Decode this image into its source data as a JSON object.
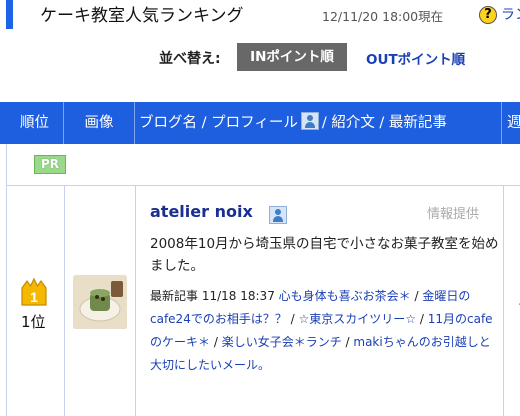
{
  "header": {
    "title": "ケーキ教室人気ランキング",
    "date": "12/11/20 18:00現在",
    "help_link": "ラン"
  },
  "sort": {
    "label": "並べ替え:",
    "active": "INポイント順",
    "other": "OUTポイント順"
  },
  "table": {
    "columns": {
      "rank": "順位",
      "image": "画像",
      "blog_part1": "ブログ名 / プロフィール",
      "blog_part2": "/ 紹介文 / 最新記事",
      "week": "週"
    },
    "pr_badge": "PR",
    "rows": [
      {
        "rank_number": "1",
        "rank_label": "1位",
        "blog_name": "atelier noix",
        "info_provided": "情報提供",
        "intro": "2008年10月から埼玉県の自宅で小さなお菓子教室を始めました。",
        "latest_label": "最新記事",
        "latest_time": "11/18 18:37",
        "posts": [
          "心も身体も喜ぶお茶会＊",
          "金曜日のcafe24でのお相手は？？",
          "☆東京スカイツリー☆",
          "11月のcafeのケーキ＊",
          "楽しい女子会＊ランチ",
          "makiちゃんのお引越しと大切にしたいメール。"
        ],
        "separator": " / ",
        "week_value": "․"
      }
    ]
  },
  "colors": {
    "header_blue": "#1e5fe0",
    "link_blue": "#1a3fb5",
    "blog_name_navy": "#1a2f8f",
    "sort_active_bg": "#686868",
    "rank_gold": "#f5b800"
  }
}
